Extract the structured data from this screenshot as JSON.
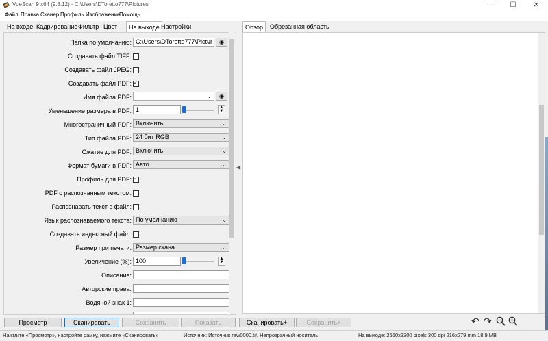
{
  "window": {
    "title": "VueScan 9 x64 (9.8.12) - C:\\Users\\DToretto777\\Pictures",
    "minimize_glyph": "—",
    "maximize_glyph": "☐",
    "close_glyph": "✕"
  },
  "menu": [
    "Файл",
    "Правка",
    "Сканер",
    "Профиль",
    "Изображение",
    "Помощь"
  ],
  "tabs_left": [
    "На входе",
    "Кадрирование",
    "Фильтр",
    "Цвет",
    "На выходе",
    "Настройки"
  ],
  "tabs_left_active": "На выходе",
  "tabs_right": [
    "Обзор",
    "Обрезанная область"
  ],
  "tabs_right_active": "Обзор",
  "rows": {
    "default_folder": {
      "label": "Папка по умолчанию:",
      "value": "C:\\Users\\DToretto777\\Pictur"
    },
    "create_tiff": {
      "label": "Создавать файл TIFF:",
      "checked": false
    },
    "create_jpeg": {
      "label": "Создавать файл JPEG:",
      "checked": false
    },
    "create_pdf": {
      "label": "Создавать файл PDF:",
      "checked": true
    },
    "pdf_filename": {
      "label": "Имя файла PDF:",
      "value": ""
    },
    "pdf_reduce": {
      "label": "Уменьшение размера в PDF:",
      "value": "1"
    },
    "multipage_pdf": {
      "label": "Многостраничный PDF:",
      "value": "Включить"
    },
    "pdf_type": {
      "label": "Тип файла PDF:",
      "value": "24 бит RGB"
    },
    "pdf_compression": {
      "label": "Сжатие для PDF:",
      "value": "Включить"
    },
    "pdf_paper": {
      "label": "Формат бумаги в PDF:",
      "value": "Авто"
    },
    "pdf_profile": {
      "label": "Профиль для PDF:",
      "checked": true
    },
    "pdf_ocr": {
      "label": "PDF с распознанным текстом:",
      "checked": false
    },
    "ocr_to_file": {
      "label": "Распознавать текст в файл:",
      "checked": false
    },
    "ocr_language": {
      "label": "Язык распознаваемого текста:",
      "value": "По умолчанию"
    },
    "index_file": {
      "label": "Создавать индексный файл:",
      "checked": false
    },
    "print_size": {
      "label": "Размер при печати:",
      "value": "Размер скана"
    },
    "magnification": {
      "label": "Увеличение (%):",
      "value": "100"
    },
    "description": {
      "label": "Описание:",
      "value": ""
    },
    "copyright": {
      "label": "Авторские права:",
      "value": ""
    },
    "watermark": {
      "label": "Водяной знак 1:",
      "value": ""
    }
  },
  "buttons": {
    "preview": "Просмотр",
    "scan": "Сканировать",
    "save": "Сохранить",
    "show": "Показать",
    "scan_plus": "Сканировать+",
    "save_plus": "Сохранить+"
  },
  "status": {
    "hint": "Нажмите «Просмотр», настройте рамку, нажмите «Сканировать»",
    "source": "Источник: Источник raw0000.tif, Непрозрачный носитель",
    "output": "На выходе: 2550x3300 pixels 300 dpi 216x279 mm 18.9 MB"
  },
  "icons": {
    "rotate_left": "rotate-left-icon",
    "rotate_right": "rotate-right-icon",
    "zoom_out": "zoom-out-icon",
    "zoom_in": "zoom-in-icon"
  },
  "colors": {
    "accent": "#1f6fd1",
    "default_button_border": "#0078d7"
  }
}
